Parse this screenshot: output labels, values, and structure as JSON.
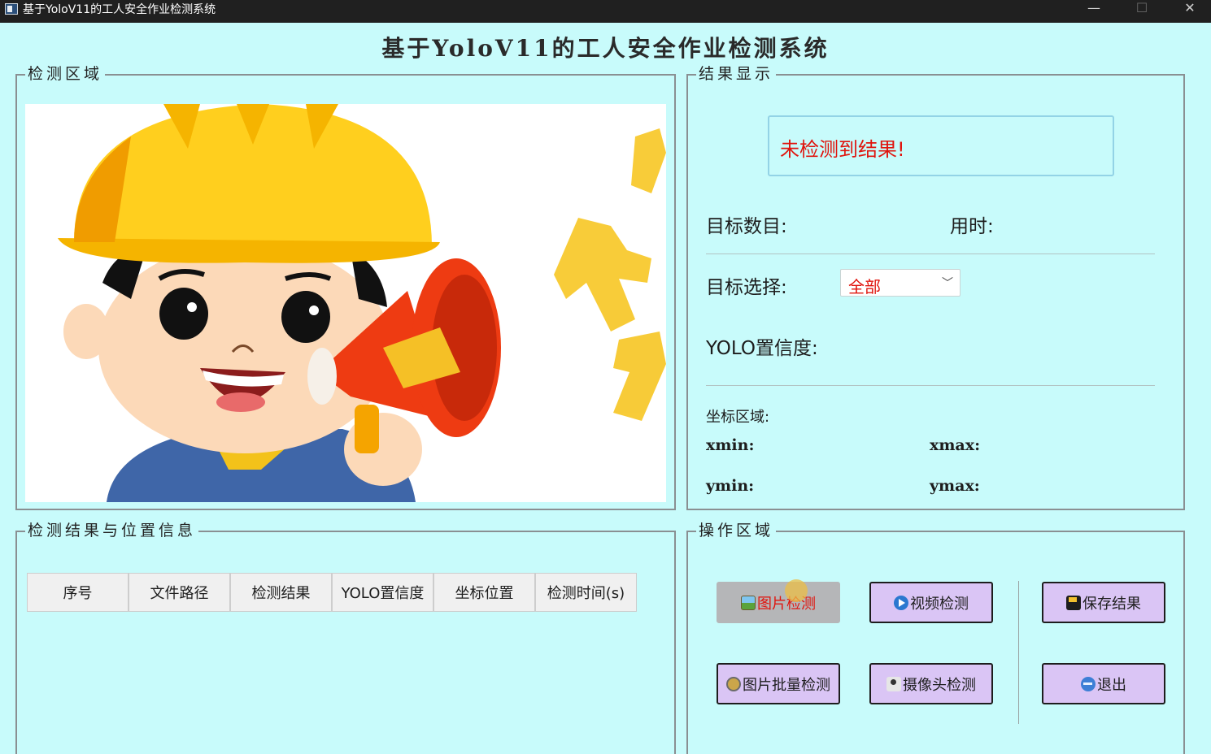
{
  "window": {
    "title": "基于YoloV11的工人安全作业检测系统",
    "controls": {
      "minimize": "—",
      "maximize": "☐",
      "close": "✕"
    }
  },
  "app_title": "基于YoloV11的工人安全作业检测系统",
  "detect_area": {
    "legend": "检测区域",
    "image_icon": "worker-with-megaphone-illustration"
  },
  "result_panel": {
    "legend": "结果显示",
    "status_text": "未检测到结果!",
    "target_count_label": "目标数目:",
    "time_label": "用时:",
    "target_select_label": "目标选择:",
    "target_select_value": "全部",
    "confidence_label": "YOLO置信度:",
    "coords_label": "坐标区域:",
    "xmin_label": "xmin:",
    "xmax_label": "xmax:",
    "ymin_label": "ymin:",
    "ymax_label": "ymax:"
  },
  "table_panel": {
    "legend": "检测结果与位置信息",
    "columns": [
      "序号",
      "文件路径",
      "检测结果",
      "YOLO置信度",
      "坐标位置",
      "检测时间(s)"
    ]
  },
  "ops_panel": {
    "legend": "操作区域",
    "buttons": {
      "image_detect": "图片检测",
      "video_detect": "视频检测",
      "save_results": "保存结果",
      "batch_detect": "图片批量检测",
      "camera_detect": "摄像头检测",
      "exit": "退出"
    },
    "active_button": "image_detect"
  },
  "colors": {
    "background": "#c8fbfb",
    "accent_red": "#e0140d",
    "button_purple": "#dac5f5",
    "button_active": "#b5b6b8"
  }
}
